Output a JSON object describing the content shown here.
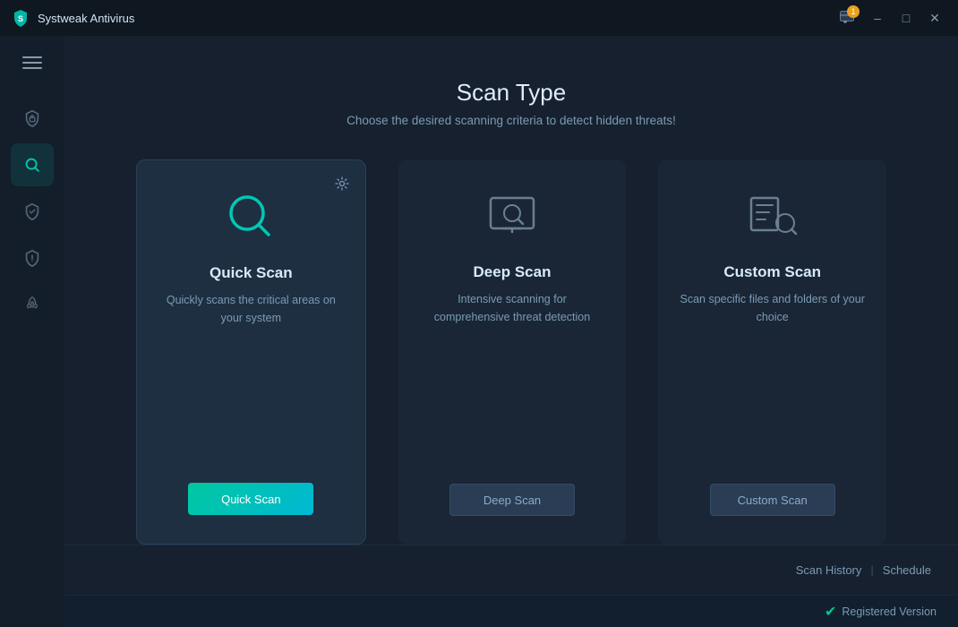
{
  "titleBar": {
    "appName": "Systweak Antivirus",
    "notificationCount": "1"
  },
  "sidebar": {
    "menuLabel": "Menu",
    "items": [
      {
        "id": "protection",
        "label": "Protection",
        "icon": "shield-lock"
      },
      {
        "id": "scan",
        "label": "Scan",
        "icon": "search",
        "active": true
      },
      {
        "id": "checkmark",
        "label": "Safe",
        "icon": "shield-check"
      },
      {
        "id": "security",
        "label": "Security",
        "icon": "shield-warning"
      },
      {
        "id": "boost",
        "label": "Boost",
        "icon": "rocket"
      }
    ]
  },
  "header": {
    "title": "Scan Type",
    "subtitle": "Choose the desired scanning criteria to detect hidden threats!"
  },
  "scanCards": [
    {
      "id": "quick",
      "title": "Quick Scan",
      "description": "Quickly scans the critical areas on your system",
      "buttonLabel": "Quick Scan",
      "buttonStyle": "primary",
      "active": true,
      "hasSettings": true
    },
    {
      "id": "deep",
      "title": "Deep Scan",
      "description": "Intensive scanning for comprehensive threat detection",
      "buttonLabel": "Deep Scan",
      "buttonStyle": "secondary",
      "active": false,
      "hasSettings": false
    },
    {
      "id": "custom",
      "title": "Custom Scan",
      "description": "Scan specific files and folders of your choice",
      "buttonLabel": "Custom Scan",
      "buttonStyle": "secondary",
      "active": false,
      "hasSettings": false
    }
  ],
  "footer": {
    "scanHistoryLabel": "Scan History",
    "divider": "|",
    "scheduleLabel": "Schedule",
    "registeredLabel": "Registered Version"
  }
}
